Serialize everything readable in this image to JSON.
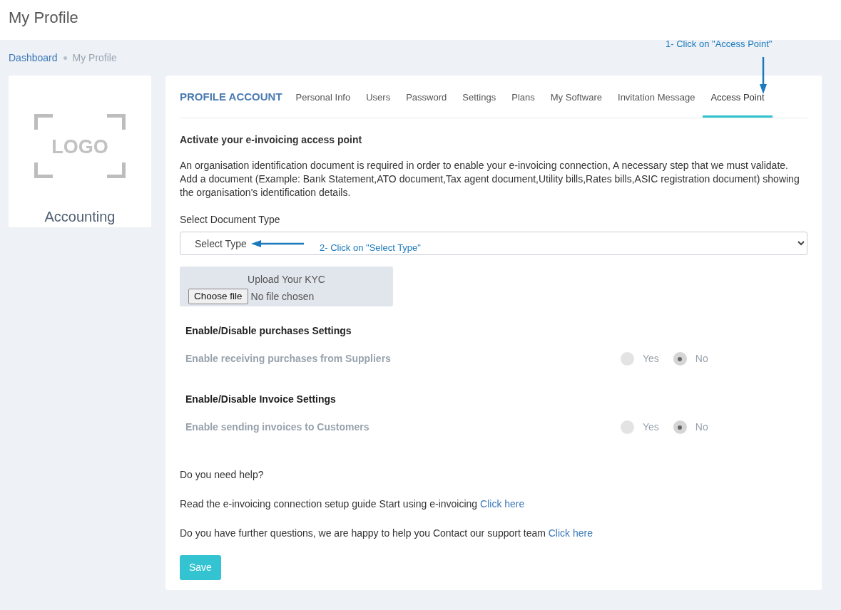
{
  "page_title": "My Profile",
  "breadcrumb": [
    {
      "label": "Dashboard",
      "kind": "link"
    },
    {
      "label": "My Profile",
      "kind": "current"
    }
  ],
  "profile_card": {
    "logo_text": "LOGO",
    "name": "Accounting"
  },
  "tabs": {
    "heading": "PROFILE ACCOUNT",
    "items": [
      {
        "label": "Personal Info",
        "selected": false
      },
      {
        "label": "Users",
        "selected": false
      },
      {
        "label": "Password",
        "selected": false
      },
      {
        "label": "Settings",
        "selected": false
      },
      {
        "label": "Plans",
        "selected": false
      },
      {
        "label": "My Software",
        "selected": false
      },
      {
        "label": "Invitation Message",
        "selected": false
      },
      {
        "label": "Access Point",
        "selected": true
      }
    ]
  },
  "section_title": "Activate your e-invoicing access point",
  "description": "An organisation identification document is required in order to enable your e-invoicing connection, A necessary step that we must validate. Add a document (Example: Bank Statement,ATO document,Tax agent document,Utility bills,Rates bills,ASIC registration document) showing the organisation's identification details.",
  "document_type": {
    "label": "Select Document Type",
    "value": "Select Type"
  },
  "upload": {
    "title": "Upload Your KYC",
    "button": "Choose file",
    "status": "No file chosen"
  },
  "settings": [
    {
      "heading": "Enable/Disable purchases Settings",
      "label": "Enable receiving purchases from Suppliers",
      "disabled": true,
      "options": [
        {
          "label": "Yes",
          "selected": false
        },
        {
          "label": "No",
          "selected": true
        }
      ]
    },
    {
      "heading": "Enable/Disable Invoice Settings",
      "label": "Enable sending invoices to Customers",
      "disabled": true,
      "options": [
        {
          "label": "Yes",
          "selected": false
        },
        {
          "label": "No",
          "selected": true
        }
      ]
    }
  ],
  "help": {
    "question": "Do you need help?",
    "lines": [
      {
        "text": "Read the e-invoicing connection setup guide Start using e-invoicing",
        "link": "Click here"
      },
      {
        "text": "Do you have further questions, we are happy to help you Contact our support team",
        "link": "Click here"
      }
    ]
  },
  "save_button": "Save",
  "annotations": [
    {
      "text": "1- Click on \"Access Point\"",
      "kind": "downward"
    },
    {
      "text": "2- Click on \"Select Type\"",
      "kind": "leftward"
    }
  ]
}
